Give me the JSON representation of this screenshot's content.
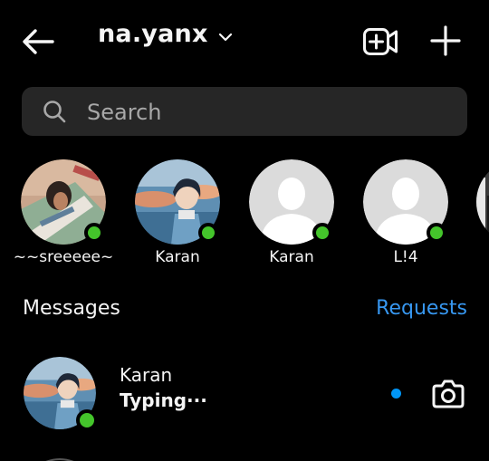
{
  "header": {
    "username": "na.yanx"
  },
  "search": {
    "placeholder": "Search"
  },
  "stories": [
    {
      "name": "~~sreeeee~",
      "avatar": "photo",
      "online": true
    },
    {
      "name": "Karan",
      "avatar": "anime",
      "online": true
    },
    {
      "name": "Karan",
      "avatar": "default",
      "online": true
    },
    {
      "name": "L!4",
      "avatar": "default",
      "online": true
    }
  ],
  "messages": {
    "title": "Messages",
    "requests_label": "Requests"
  },
  "threads": [
    {
      "name": "Karan",
      "preview": "Typing···",
      "unread": true,
      "online": true,
      "avatar": "anime"
    }
  ],
  "colors": {
    "background": "#000000",
    "search_bg": "#262626",
    "accent_blue": "#3797f0",
    "online_green": "#44c52b"
  },
  "icons": [
    "back-arrow-icon",
    "chevron-down-icon",
    "new-video-call-icon",
    "plus-icon",
    "search-icon",
    "camera-icon"
  ]
}
